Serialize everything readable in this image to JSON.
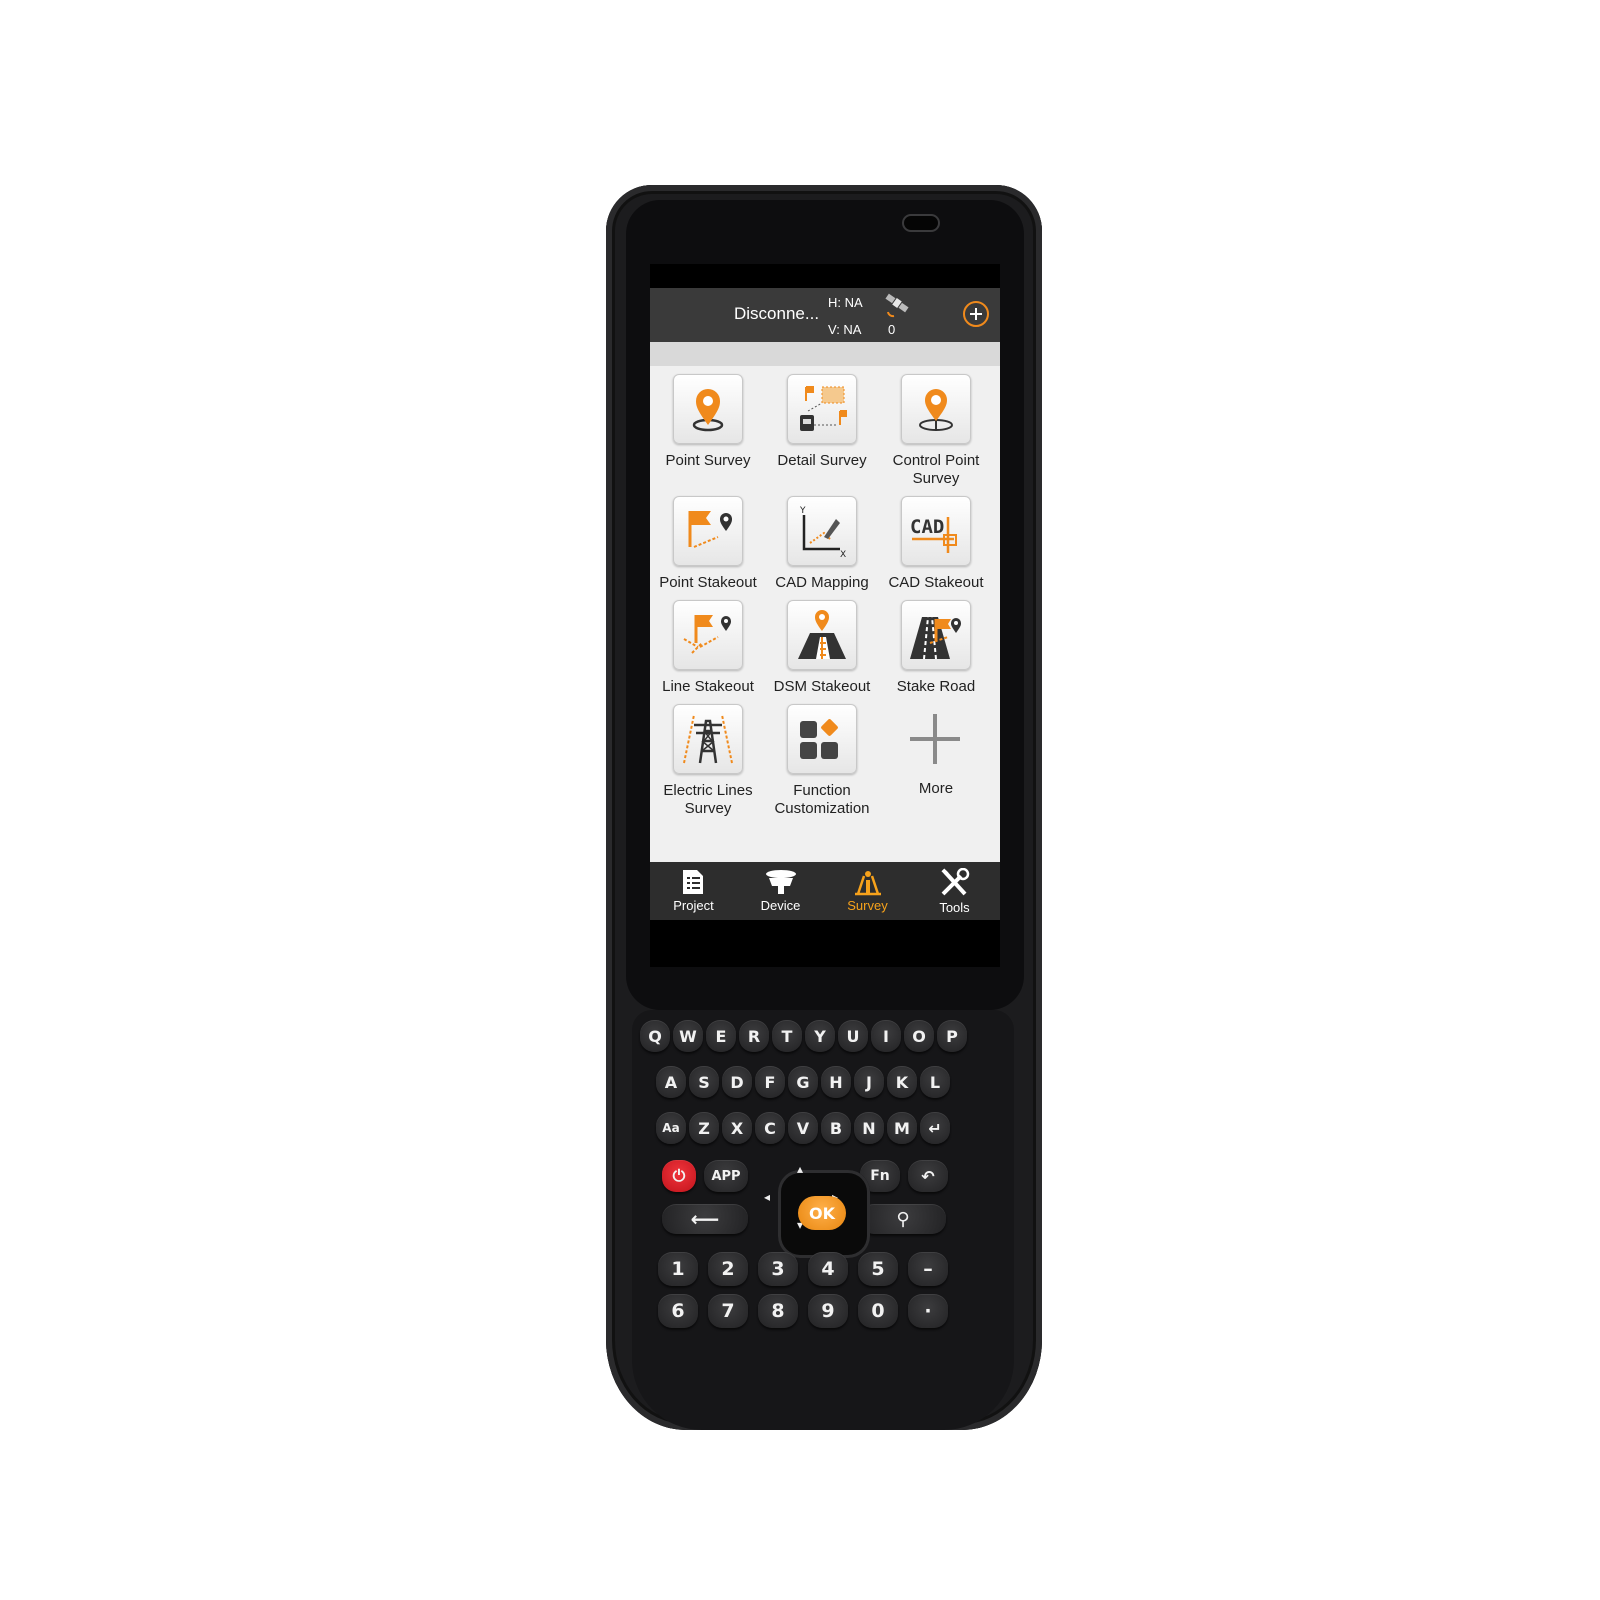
{
  "status_bar": {
    "connection": "Disconne...",
    "h_label": "H: NA",
    "v_label": "V: NA",
    "satellite_count": "0",
    "add_icon": "plus-circle-icon"
  },
  "tiles": [
    {
      "label": "Point Survey",
      "icon": "point-survey-icon"
    },
    {
      "label": "Detail Survey",
      "icon": "detail-survey-icon"
    },
    {
      "label": "Control Point Survey",
      "icon": "control-point-survey-icon"
    },
    {
      "label": "Point Stakeout",
      "icon": "point-stakeout-icon"
    },
    {
      "label": "CAD Mapping",
      "icon": "cad-mapping-icon"
    },
    {
      "label": "CAD Stakeout",
      "icon": "cad-stakeout-icon"
    },
    {
      "label": "Line Stakeout",
      "icon": "line-stakeout-icon"
    },
    {
      "label": "DSM Stakeout",
      "icon": "dsm-stakeout-icon"
    },
    {
      "label": "Stake Road",
      "icon": "stake-road-icon"
    },
    {
      "label": "Electric Lines Survey",
      "icon": "electric-lines-icon"
    },
    {
      "label": "Function Customization",
      "icon": "function-customization-icon"
    },
    {
      "label": "More",
      "icon": "plus-icon"
    }
  ],
  "nav": [
    {
      "label": "Project",
      "icon": "project-icon",
      "active": false
    },
    {
      "label": "Device",
      "icon": "device-icon",
      "active": false
    },
    {
      "label": "Survey",
      "icon": "survey-icon",
      "active": true
    },
    {
      "label": "Tools",
      "icon": "tools-icon",
      "active": false
    }
  ],
  "keypad": {
    "row1": [
      "Q",
      "W",
      "E",
      "R",
      "T",
      "Y",
      "U",
      "I",
      "O",
      "P"
    ],
    "row2": [
      "A",
      "S",
      "D",
      "F",
      "G",
      "H",
      "J",
      "K",
      "L"
    ],
    "row3": [
      "Aa",
      "Z",
      "X",
      "C",
      "V",
      "B",
      "N",
      "M",
      "↵"
    ],
    "power": "⏻",
    "app": "APP",
    "fn": "Fn",
    "back": "↶",
    "backspace": "⟵",
    "location": "⚲",
    "ok": "OK",
    "num1": [
      "1",
      "2",
      "3",
      "4",
      "5",
      "–"
    ],
    "num2": [
      "6",
      "7",
      "8",
      "9",
      "0",
      "·"
    ]
  },
  "colors": {
    "accent": "#f08a1c",
    "active_nav": "#f7a21b",
    "device_body": "#1c1c1e",
    "app_bar": "#3a3a3a"
  }
}
